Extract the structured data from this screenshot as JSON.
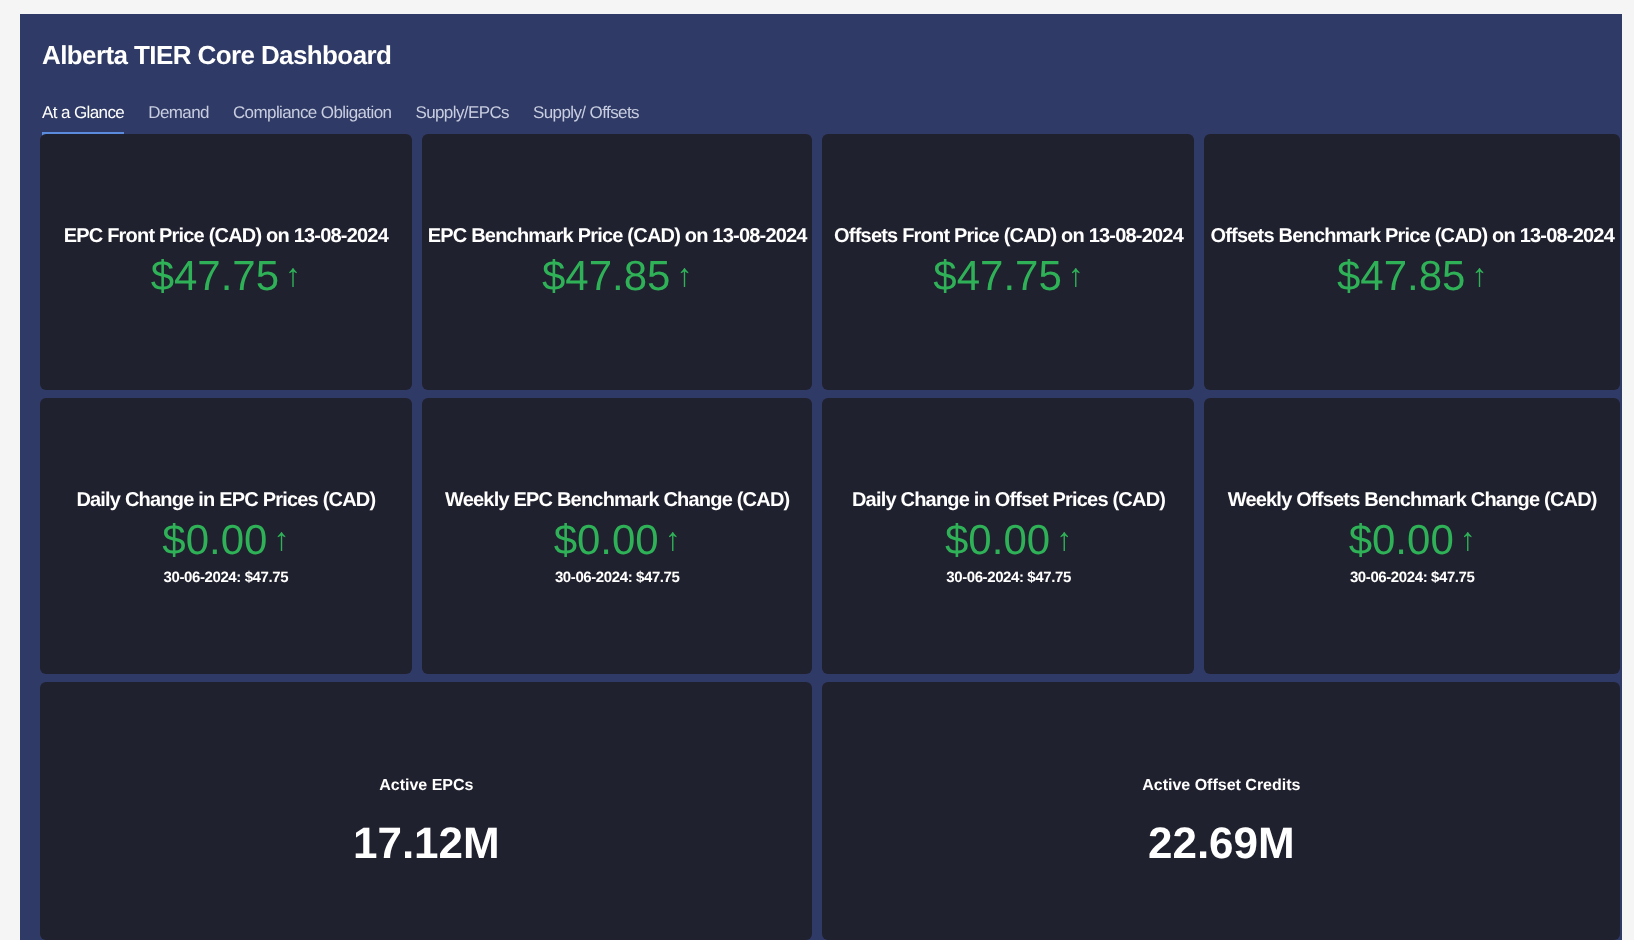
{
  "title": "Alberta TIER Core Dashboard",
  "tabs": [
    {
      "label": "At a Glance",
      "selected": true
    },
    {
      "label": "Demand",
      "selected": false
    },
    {
      "label": "Compliance Obligation",
      "selected": false
    },
    {
      "label": "Supply/EPCs",
      "selected": false
    },
    {
      "label": "Supply/ Offsets",
      "selected": false
    }
  ],
  "price_cards": [
    {
      "title": "EPC Front Price (CAD) on 13-08-2024",
      "value": "$47.75",
      "arrow": "↑"
    },
    {
      "title": "EPC Benchmark Price (CAD) on 13-08-2024",
      "value": "$47.85",
      "arrow": "↑"
    },
    {
      "title": "Offsets Front Price (CAD) on 13-08-2024",
      "value": "$47.75",
      "arrow": "↑"
    },
    {
      "title": "Offsets Benchmark Price (CAD) on 13-08-2024",
      "value": "$47.85",
      "arrow": "↑"
    }
  ],
  "change_cards": [
    {
      "title": "Daily Change in EPC Prices (CAD)",
      "value": "$0.00",
      "arrow": "↑",
      "note": "30-06-2024: $47.75"
    },
    {
      "title": "Weekly EPC Benchmark Change (CAD)",
      "value": "$0.00",
      "arrow": "↑",
      "note": "30-06-2024: $47.75"
    },
    {
      "title": "Daily Change in Offset Prices (CAD)",
      "value": "$0.00",
      "arrow": "↑",
      "note": "30-06-2024: $47.75"
    },
    {
      "title": "Weekly Offsets Benchmark Change (CAD)",
      "value": "$0.00",
      "arrow": "↑",
      "note": "30-06-2024: $47.75"
    }
  ],
  "total_cards": [
    {
      "title": "Active EPCs",
      "value": "17.12M"
    },
    {
      "title": "Active Offset Credits",
      "value": "22.69M"
    }
  ]
}
